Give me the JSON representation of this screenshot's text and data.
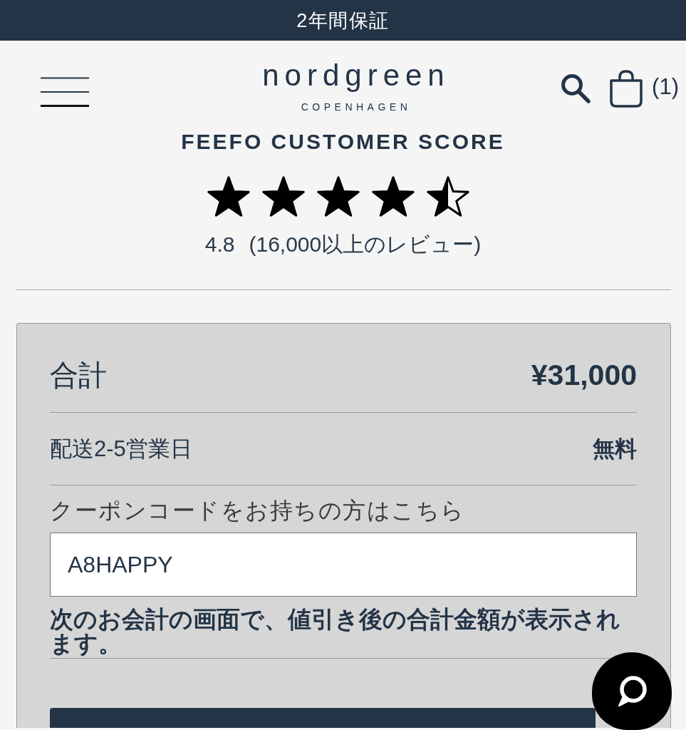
{
  "announcement_bar": {
    "text": "2年間保証"
  },
  "header": {
    "logo": {
      "wordmark": "nordgreen",
      "tagline": "COPENHAGEN"
    },
    "cart_count": "(1)"
  },
  "rating": {
    "title": "FEEFO CUSTOMER SCORE",
    "stars": 4.5,
    "score": "4.8",
    "review_count": "(16,000以上のレビュー)"
  },
  "summary": {
    "rows": [
      {
        "kind": "total",
        "label": "合計",
        "value": "¥31,000"
      },
      {
        "kind": "shipping",
        "label": "配送2-5営業日",
        "value": "無料"
      }
    ],
    "coupon": {
      "label": "クーポンコードをお持ちの方はこちら",
      "value": "A8HAPPY"
    },
    "note": "次のお会計の画面で、値引き後の合計金額が表示されます。"
  }
}
